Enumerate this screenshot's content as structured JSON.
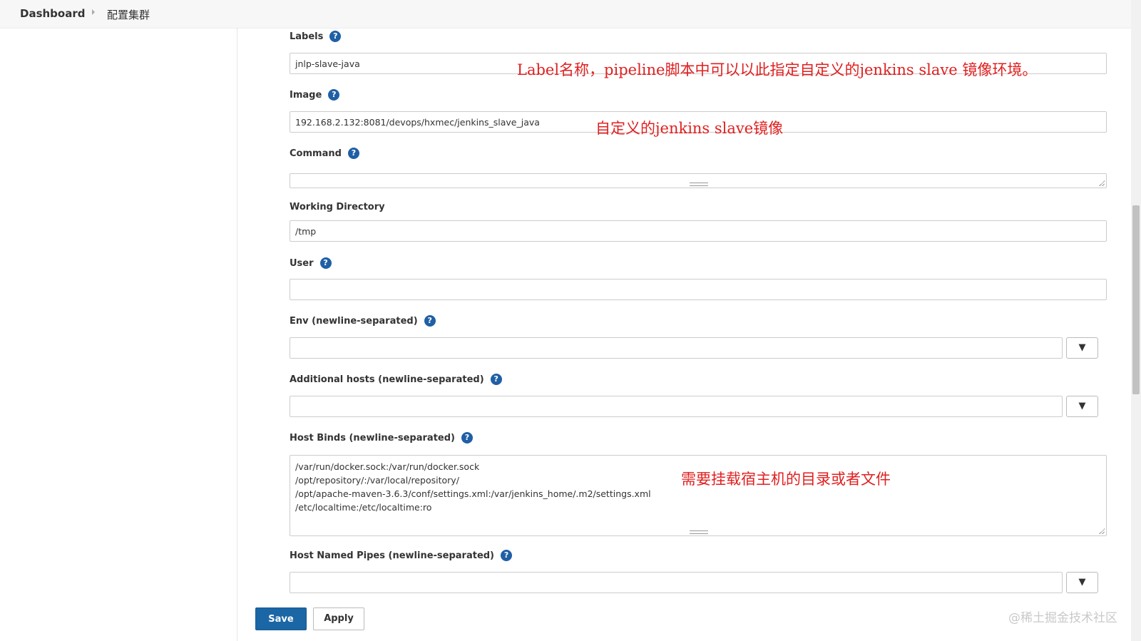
{
  "breadcrumb": {
    "home": "Dashboard",
    "current": "配置集群"
  },
  "help_glyph": "?",
  "fields": {
    "labels": {
      "label": "Labels",
      "value": "jnlp-slave-java"
    },
    "image": {
      "label": "Image",
      "value": "192.168.2.132:8081/devops/hxmec/jenkins_slave_java"
    },
    "command": {
      "label": "Command",
      "value": ""
    },
    "workdir": {
      "label": "Working Directory",
      "value": "/tmp"
    },
    "user": {
      "label": "User",
      "value": ""
    },
    "env": {
      "label": "Env (newline-separated)",
      "value": ""
    },
    "hosts": {
      "label": "Additional hosts (newline-separated)",
      "value": ""
    },
    "binds": {
      "label": "Host Binds (newline-separated)",
      "lines": [
        "/var/run/docker.sock:/var/run/docker.sock",
        "/opt/repository/:/var/local/repository/",
        "/opt/apache-maven-3.6.3/conf/settings.xml:/var/jenkins_home/.m2/settings.xml",
        "/etc/localtime:/etc/localtime:ro"
      ]
    },
    "pipes": {
      "label": "Host Named Pipes (newline-separated)",
      "value": ""
    }
  },
  "dropdown_glyph": "▼",
  "annotations": {
    "labels": "Label名称，pipeline脚本中可以以此指定自定义的jenkins slave 镜像环境。",
    "image": "自定义的jenkins slave镜像",
    "binds": "需要挂载宿主机的目录或者文件",
    "color": "#e02020"
  },
  "buttons": {
    "save": "Save",
    "apply": "Apply"
  },
  "watermark": "@稀土掘金技术社区",
  "colors": {
    "accent": "#1b66a5",
    "help": "#1f5fa6"
  }
}
